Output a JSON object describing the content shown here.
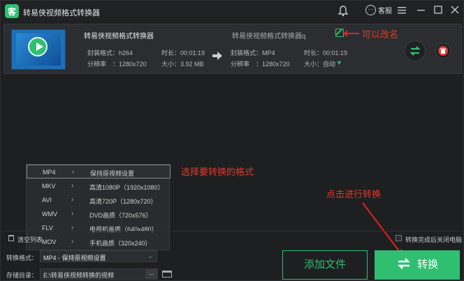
{
  "window": {
    "title": "转易侠视频格式转换器",
    "service_label": "客服"
  },
  "file": {
    "name": "转易侠视频格式转换器",
    "output_name": "转易侠视频格式转换器q",
    "source": {
      "container_label": "封装格式：h264",
      "duration_label": "时长：00:01:19",
      "resolution_label": "分辨率",
      "resolution_value": "：1280x720",
      "size_label": "大小：3.92 MB"
    },
    "target": {
      "container_label": "封装格式：MP4",
      "duration_label": "时长：00:01:19",
      "resolution_label": "分辨率",
      "resolution_value": "：1280x720",
      "size_label": "大小：自动"
    }
  },
  "annotations": {
    "rename": "可以改名",
    "choose_format": "选择要转换的格式",
    "click_convert": "点击进行转换"
  },
  "format_list": [
    {
      "format": "MP4",
      "desc": "保持原视频设置"
    },
    {
      "format": "MKV",
      "desc": "高清1080P（1920x1080）"
    },
    {
      "format": "AVI",
      "desc": "高清720P（1280x720）"
    },
    {
      "format": "WMV",
      "desc": "DVD画质（720x576）"
    },
    {
      "format": "FLV",
      "desc": "电视机画质（640x480）"
    },
    {
      "format": "MOV",
      "desc": "手机画质（320x240）"
    }
  ],
  "bottom": {
    "clear_list": "清空列表",
    "shutdown_after": "转换完成后关闭电脑",
    "format_label": "转换格式：",
    "format_value": "MP4 - 保持原视频设置",
    "dir_label": "存储目录：",
    "dir_value": "E:\\转易侠视频转换的视频",
    "browse_label": "...",
    "add_file": "添加文件",
    "convert": "转换"
  },
  "colors": {
    "accent": "#2fbf71",
    "annotation": "#e23a2a",
    "background": "#1e1f21"
  }
}
